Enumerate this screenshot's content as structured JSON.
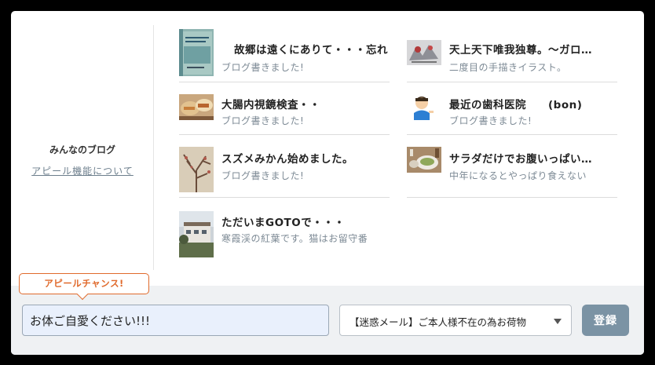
{
  "sidebar": {
    "title": "みんなのブログ",
    "link": "アピール機能について"
  },
  "blogs": [
    {
      "title": "故郷は遠くにありて・・・忘れ",
      "subtitle": "ブログ書きました!",
      "thumb": "book-cover-thumbnail"
    },
    {
      "title": "天上天下唯我独尊。〜ガロ…",
      "subtitle": "二度目の手描きイラスト。",
      "thumb": "illustration-thumbnail"
    },
    {
      "title": "大腸内視鏡検査・・",
      "subtitle": "ブログ書きました!",
      "thumb": "food-thumbnail"
    },
    {
      "title": "最近の歯科医院　　(bon)",
      "subtitle": "ブログ書きました!",
      "thumb": "avatar-thumbnail"
    },
    {
      "title": "スズメみかん始めました。",
      "subtitle": "ブログ書きました!",
      "thumb": "tree-thumbnail"
    },
    {
      "title": "サラダだけでお腹いっぱい…",
      "subtitle": "中年になるとやっぱり食えない",
      "thumb": "salad-thumbnail"
    },
    {
      "title": "ただいまGOTOで・・・",
      "subtitle": "寒霞渓の紅葉です。猫はお留守番",
      "thumb": "building-thumbnail"
    }
  ],
  "appeal": {
    "badge": "アピールチャンス!",
    "input_value": "お体ご自愛ください!!!",
    "select_value": "【迷惑メール】ご本人様不在の為お荷物",
    "submit_label": "登録"
  },
  "colors": {
    "accent": "#e06a2c",
    "button": "#7b93a4",
    "link": "#6c7e8c",
    "input_bg": "#e9f0fc"
  }
}
